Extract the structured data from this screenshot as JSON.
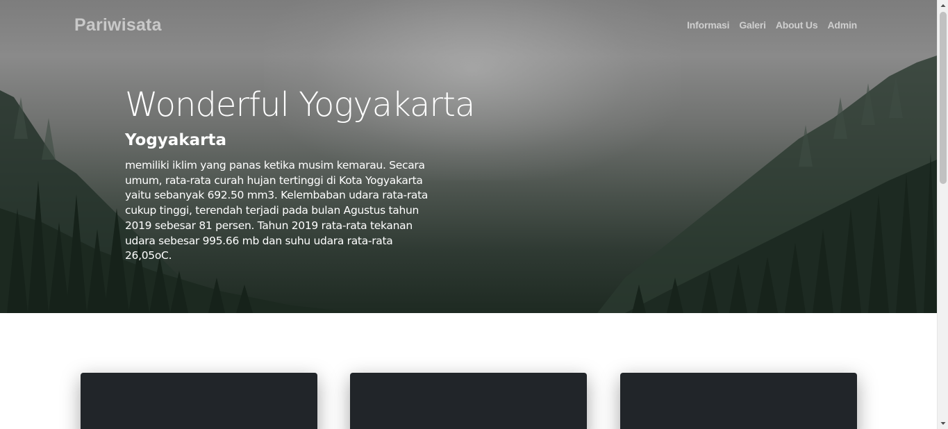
{
  "navbar": {
    "brand": "Pariwisata",
    "links": [
      "Informasi",
      "Galeri",
      "About Us",
      "Admin"
    ]
  },
  "hero": {
    "title": "Wonderful Yogyakarta",
    "subtitle": "Yogyakarta",
    "text": "memiliki iklim yang panas ketika musim kemarau. Secara umum, rata-rata curah hujan tertinggi di Kota Yogyakarta yaitu sebanyak 692.50 mm3. Kelembaban udara rata-rata cukup tinggi, terendah terjadi pada bulan Agustus tahun 2019 sebesar 81 persen. Tahun 2019 rata-rata tekanan udara sebesar 995.66 mb dan suhu udara rata-rata 26,05oC."
  },
  "colors": {
    "card": "#212529",
    "nav_text": "#cfcfcf",
    "hero_text": "#ffffff"
  },
  "icons": {
    "scroll_up": "triangle-up-icon",
    "scroll_down": "triangle-down-icon"
  }
}
